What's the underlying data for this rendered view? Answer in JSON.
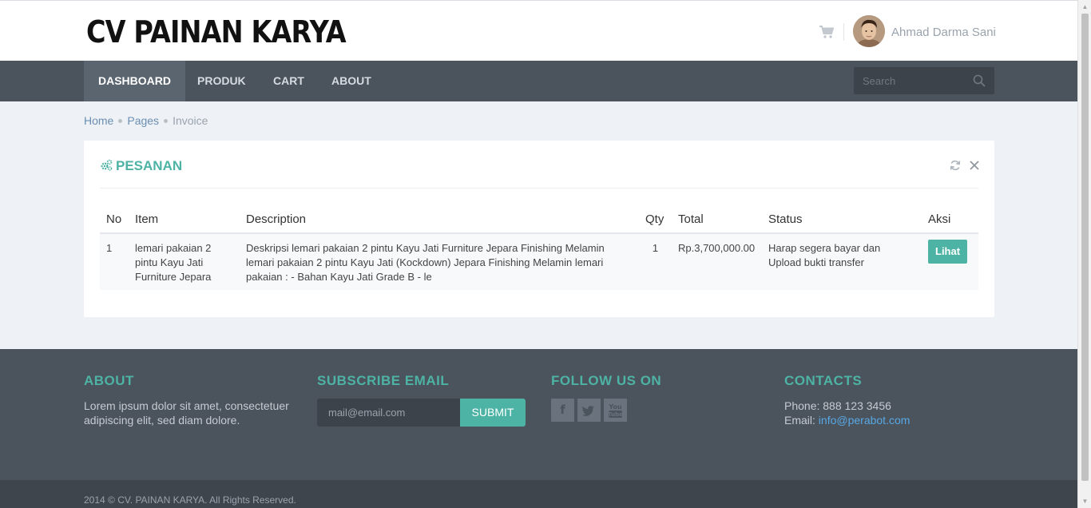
{
  "header": {
    "logo_text": "CV PAINAN KARYA",
    "user_name": "Ahmad Darma Sani",
    "cart_icon": "shopping-cart-icon"
  },
  "nav": {
    "items": [
      {
        "label": "DASHBOARD",
        "active": true
      },
      {
        "label": "PRODUK",
        "active": false
      },
      {
        "label": "CART",
        "active": false
      },
      {
        "label": "ABOUT",
        "active": false
      }
    ],
    "search_placeholder": "Search"
  },
  "breadcrumb": {
    "home": "Home",
    "pages": "Pages",
    "current": "Invoice"
  },
  "portlet": {
    "title": "PESANAN",
    "table": {
      "headers": [
        "No",
        "Item",
        "Description",
        "Qty",
        "Total",
        "Status",
        "Aksi"
      ],
      "rows": [
        {
          "no": "1",
          "item": "lemari pakaian 2 pintu Kayu Jati Furniture Jepara",
          "description": "Deskripsi lemari pakaian 2 pintu Kayu Jati Furniture Jepara Finishing Melamin lemari pakaian 2 pintu Kayu Jati (Kockdown) Jepara Finishing Melamin lemari pakaian : - Bahan Kayu Jati Grade B - le",
          "qty": "1",
          "total": "Rp.3,700,000.00",
          "status": "Harap segera bayar dan Upload bukti transfer",
          "action": "Lihat"
        }
      ]
    }
  },
  "footer": {
    "about_title": "ABOUT",
    "about_text": "Lorem ipsum dolor sit amet, consectetuer adipiscing elit, sed diam dolore.",
    "subscribe_title": "SUBSCRIBE EMAIL",
    "subscribe_placeholder": "mail@email.com",
    "subscribe_button": "SUBMIT",
    "follow_title": "FOLLOW US ON",
    "contacts_title": "CONTACTS",
    "phone": "Phone: 888 123 3456",
    "email_label": "Email: ",
    "email_link": "info@perabot.com",
    "copyright": "2014 © CV. PAINAN KARYA. All Rights Reserved."
  },
  "colors": {
    "accent": "#4db3a4",
    "nav_bg": "#4b535d",
    "link": "#58a8e4"
  }
}
